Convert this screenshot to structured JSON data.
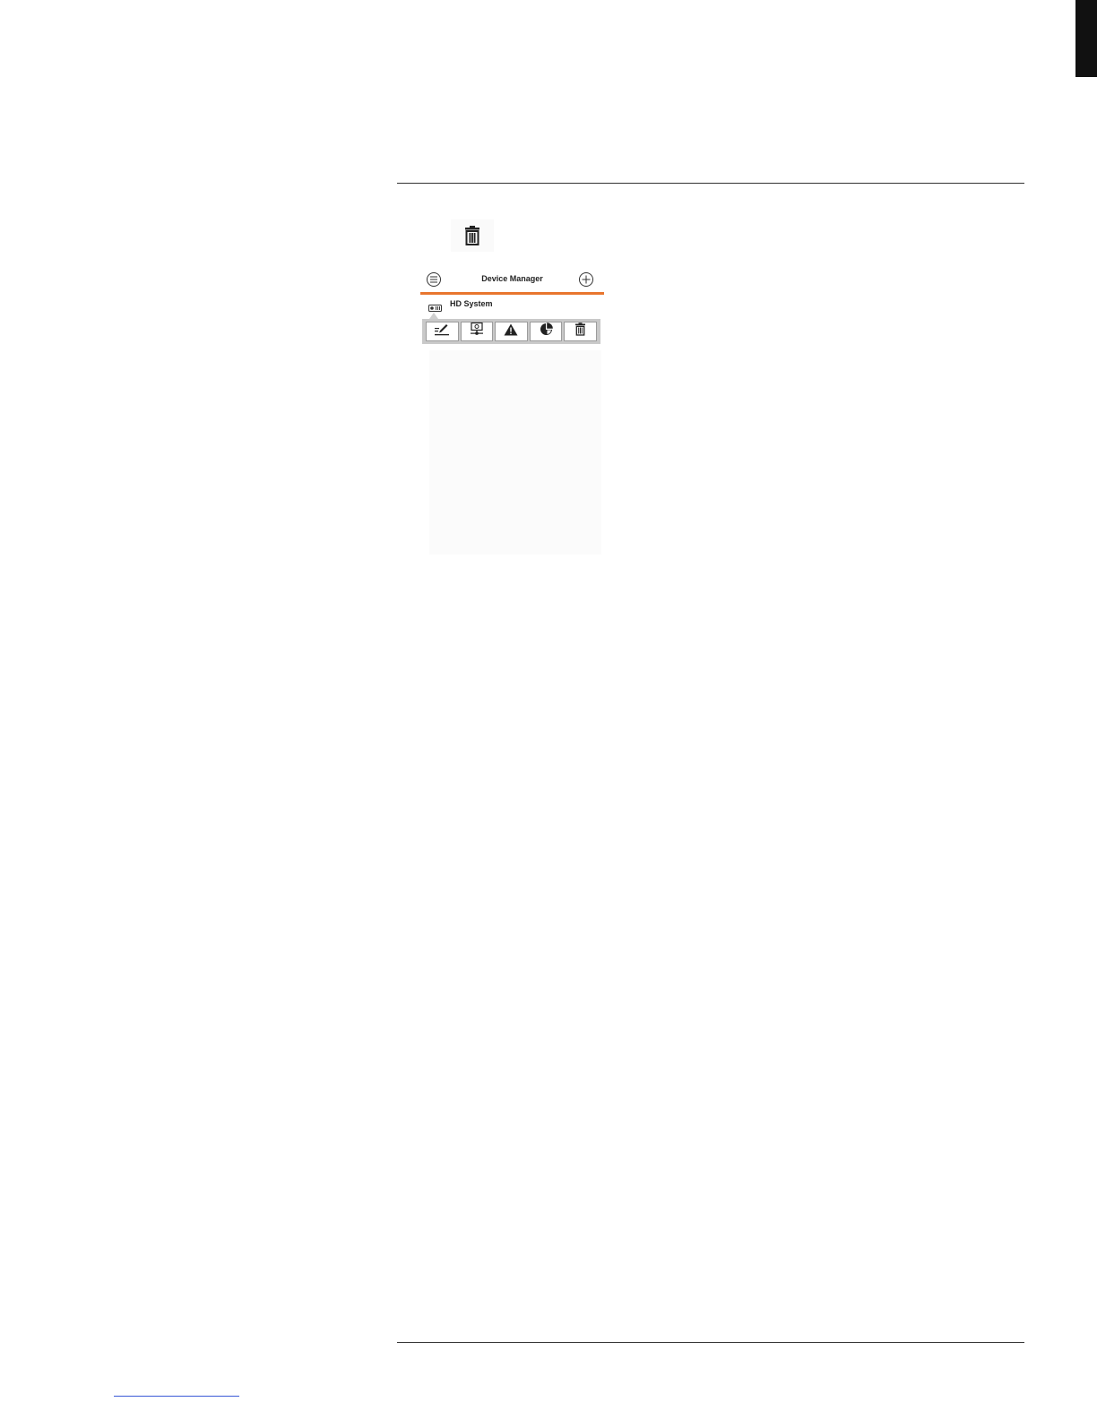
{
  "app": {
    "header": {
      "title": "Device Manager",
      "menu_icon": "menu-icon",
      "add_icon": "add-icon"
    },
    "device": {
      "name": "HD System",
      "icon": "dvr-device-icon"
    },
    "action_bar": {
      "items": [
        {
          "icon": "edit-icon"
        },
        {
          "icon": "remote-config-icon"
        },
        {
          "icon": "alert-icon"
        },
        {
          "icon": "storage-pie-icon"
        },
        {
          "icon": "trash-icon"
        }
      ]
    },
    "colors": {
      "accent": "#e8762e",
      "action_bar_bg": "#c9c9c9"
    }
  },
  "inline_icon": "trash-icon"
}
